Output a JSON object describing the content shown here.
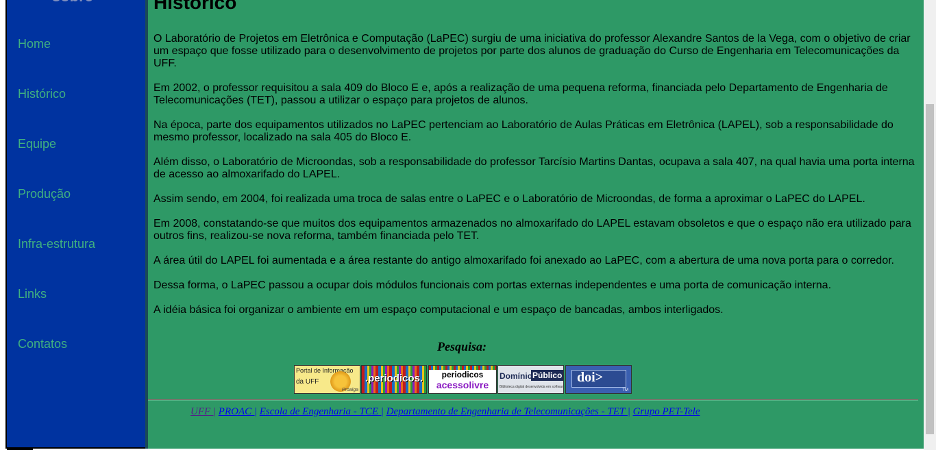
{
  "sidebar": {
    "top_text": "sobre",
    "items": [
      {
        "label": "Home"
      },
      {
        "label": "Histórico"
      },
      {
        "label": "Equipe"
      },
      {
        "label": "Produção"
      },
      {
        "label": "Infra-estrutura"
      },
      {
        "label": "Links"
      },
      {
        "label": "Contatos"
      }
    ]
  },
  "main": {
    "title": "Histórico",
    "paragraphs": [
      "O Laboratório de Projetos em Eletrônica e Computação (LaPEC) surgiu de uma iniciativa do professor Alexandre Santos de la Vega, com o objetivo de criar um espaço que fosse utilizado para o desenvolvimento de projetos por parte dos alunos de graduação do Curso de Engenharia em Telecomunicações da UFF.",
      "Em 2002, o professor requisitou a sala 409 do Bloco E e, após a realização de uma pequena reforma, financiada pelo Departamento de Engenharia de Telecomunicações (TET), passou a utilizar o espaço para projetos de alunos.",
      "Na época, parte dos equipamentos utilizados no LaPEC pertenciam ao Laboratório de Aulas Práticas em Eletrônica (LAPEL), sob a responsabilidade do mesmo professor, localizado na sala 405 do Bloco E.",
      "Além disso, o Laboratório de Microondas, sob a responsabilidade do professor Tarcísio Martins Dantas, ocupava a sala 407, na qual havia uma porta interna de acesso ao almoxarifado do LAPEL.",
      "Assim sendo, em 2004, foi realizada uma troca de salas entre o LaPEC e o Laboratório de Microondas, de forma a aproximar o LaPEC do LAPEL.",
      "Em 2008, constatando-se que muitos dos equipamentos armazenados no almoxarifado do LAPEL estavam obsoletos e que o espaço não era utilizado para outros fins, realizou-se nova reforma, também financiada pelo TET.",
      "A área útil do LAPEL foi aumentada e a área restante do antigo almoxarifado foi anexado ao LaPEC, com a abertura de uma nova porta para o corredor.",
      "Dessa forma, o LaPEC passou a ocupar dois módulos funcionais com portas externas independentes e uma porta de comunicação interna.",
      "A idéia básica foi organizar o ambiente em um espaço computacional e um espaço de bancadas, ambos interligados."
    ],
    "search_label": "Pesquisa:",
    "logos": [
      {
        "text_line1": "Portal de Informação",
        "text_line2": "da UFF",
        "text_line3": "Proaiga"
      },
      {
        "text": ".periodicos."
      },
      {
        "text_line1": "periodicos",
        "text_line2": "acessolivre"
      },
      {
        "text_line1": "Domínio",
        "text_line2": "Público",
        "text_line3": "Biblioteca digital desenvolvida em software livre"
      },
      {
        "text": "doi>",
        "tm": "TM"
      }
    ]
  },
  "footer": {
    "links": [
      {
        "label": "UFF |"
      },
      {
        "label": "PROAC |"
      },
      {
        "label": "Escola de Engenharia - TCE |"
      },
      {
        "label": "Departamento de Engenharia de Telecomunicações - TET |"
      },
      {
        "label": "Grupo PET-Tele"
      }
    ]
  },
  "colors": {
    "page_bg": "#2e9966",
    "sidebar_bg": "#0033a0",
    "nav_text": "#40b080",
    "link": "#0000ee",
    "visited_link": "#551a8b"
  }
}
